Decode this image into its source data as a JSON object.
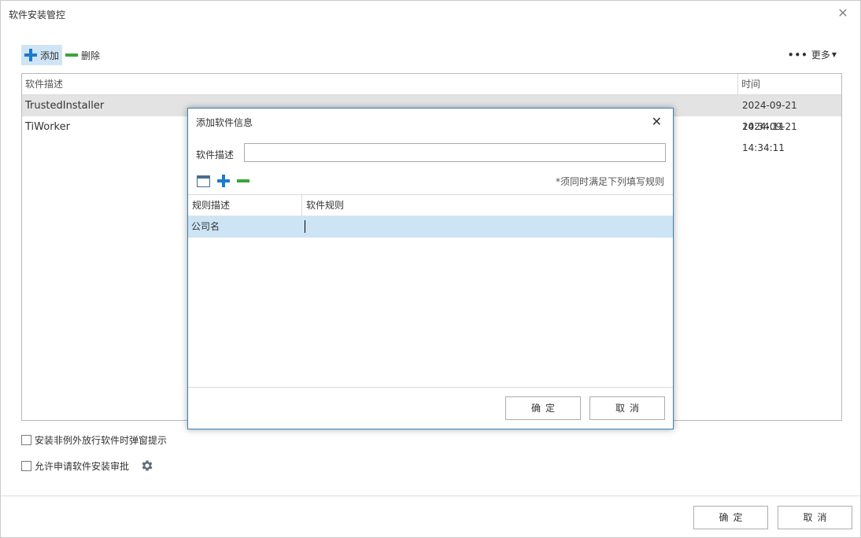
{
  "window": {
    "title": "软件安装管控"
  },
  "toolbar": {
    "add_label": "添加",
    "delete_label": "删除",
    "more_label": "更多"
  },
  "table": {
    "columns": [
      "软件描述",
      "时间"
    ],
    "rows": [
      {
        "name": "TrustedInstaller",
        "time": "2024-09-21 14:34:11"
      },
      {
        "name": "TiWorker",
        "time": "2024-09-21 14:34:11"
      }
    ]
  },
  "options": {
    "popup_label": "安装非例外放行软件时弹窗提示",
    "approval_label": "允许申请软件安装审批"
  },
  "footer": {
    "ok_label": "确定",
    "cancel_label": "取消"
  },
  "dialog": {
    "title": "添加软件信息",
    "desc_label": "软件描述",
    "desc_value": "",
    "hint": "*须同时满足下列填写规则",
    "grid": {
      "columns": [
        "规则描述",
        "软件规则"
      ],
      "rows": [
        {
          "rule": "公司名",
          "value": ""
        }
      ]
    },
    "ok_label": "确定",
    "cancel_label": "取消"
  }
}
